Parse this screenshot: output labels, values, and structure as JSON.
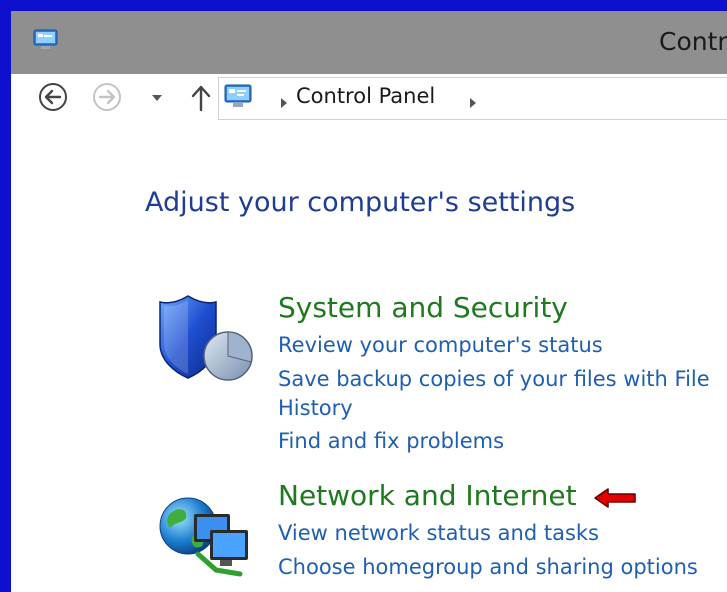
{
  "window": {
    "title": "Contr"
  },
  "address_bar": {
    "breadcrumb": "Control Panel"
  },
  "main": {
    "heading": "Adjust your computer's settings",
    "categories": [
      {
        "title": "System and Security",
        "icon": "shield-icon",
        "links": [
          "Review your computer's status",
          "Save backup copies of your files with File",
          "History",
          "Find and fix problems"
        ]
      },
      {
        "title": "Network and Internet",
        "icon": "network-globe-icon",
        "links": [
          "View network status and tasks",
          "Choose homegroup and sharing options"
        ]
      }
    ],
    "annotation": {
      "icon": "red-arrow-icon",
      "color": "#e00000"
    }
  }
}
